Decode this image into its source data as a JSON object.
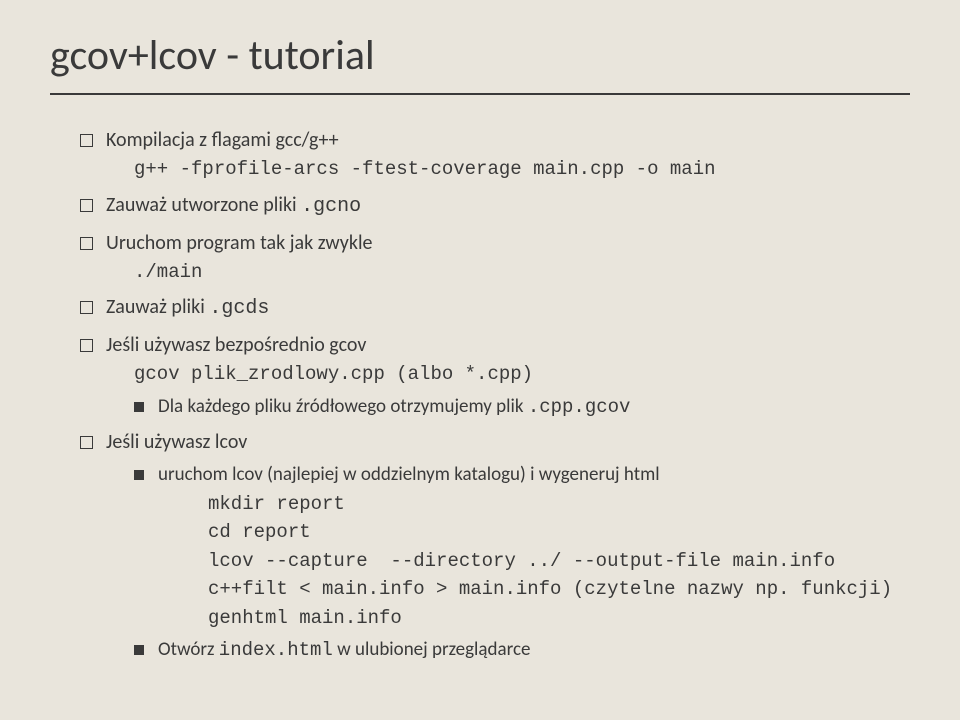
{
  "title": "gcov+lcov - tutorial",
  "items": [
    {
      "text": "Kompilacja z flagami gcc/g++",
      "code": "g++ -fprofile-arcs -ftest-coverage main.cpp -o main"
    },
    {
      "text_pre": "Zauważ utworzone pliki ",
      "text_code": ".gcno"
    },
    {
      "text": "Uruchom program tak jak zwykle",
      "code": "./main"
    },
    {
      "text_pre": "Zauważ pliki ",
      "text_code": ".gcds"
    },
    {
      "text": "Jeśli używasz bezpośrednio gcov",
      "code": "gcov plik_zrodlowy.cpp (albo *.cpp)",
      "sub": [
        {
          "text_pre": "Dla każdego pliku źródłowego otrzymujemy plik ",
          "text_code": ".cpp.gcov"
        }
      ]
    },
    {
      "text": "Jeśli używasz lcov",
      "sub": [
        {
          "text": "uruchom lcov (najlepiej w oddzielnym katalogu) i wygeneruj html",
          "codeblock": "mkdir report\ncd report\nlcov --capture  --directory ../ --output-file main.info\nc++filt < main.info > main.info (czytelne nazwy np. funkcji)\ngenhtml main.info"
        },
        {
          "text_pre": "Otwórz ",
          "text_code": "index.html",
          "text_post": "  w ulubionej przeglądarce"
        }
      ]
    }
  ]
}
